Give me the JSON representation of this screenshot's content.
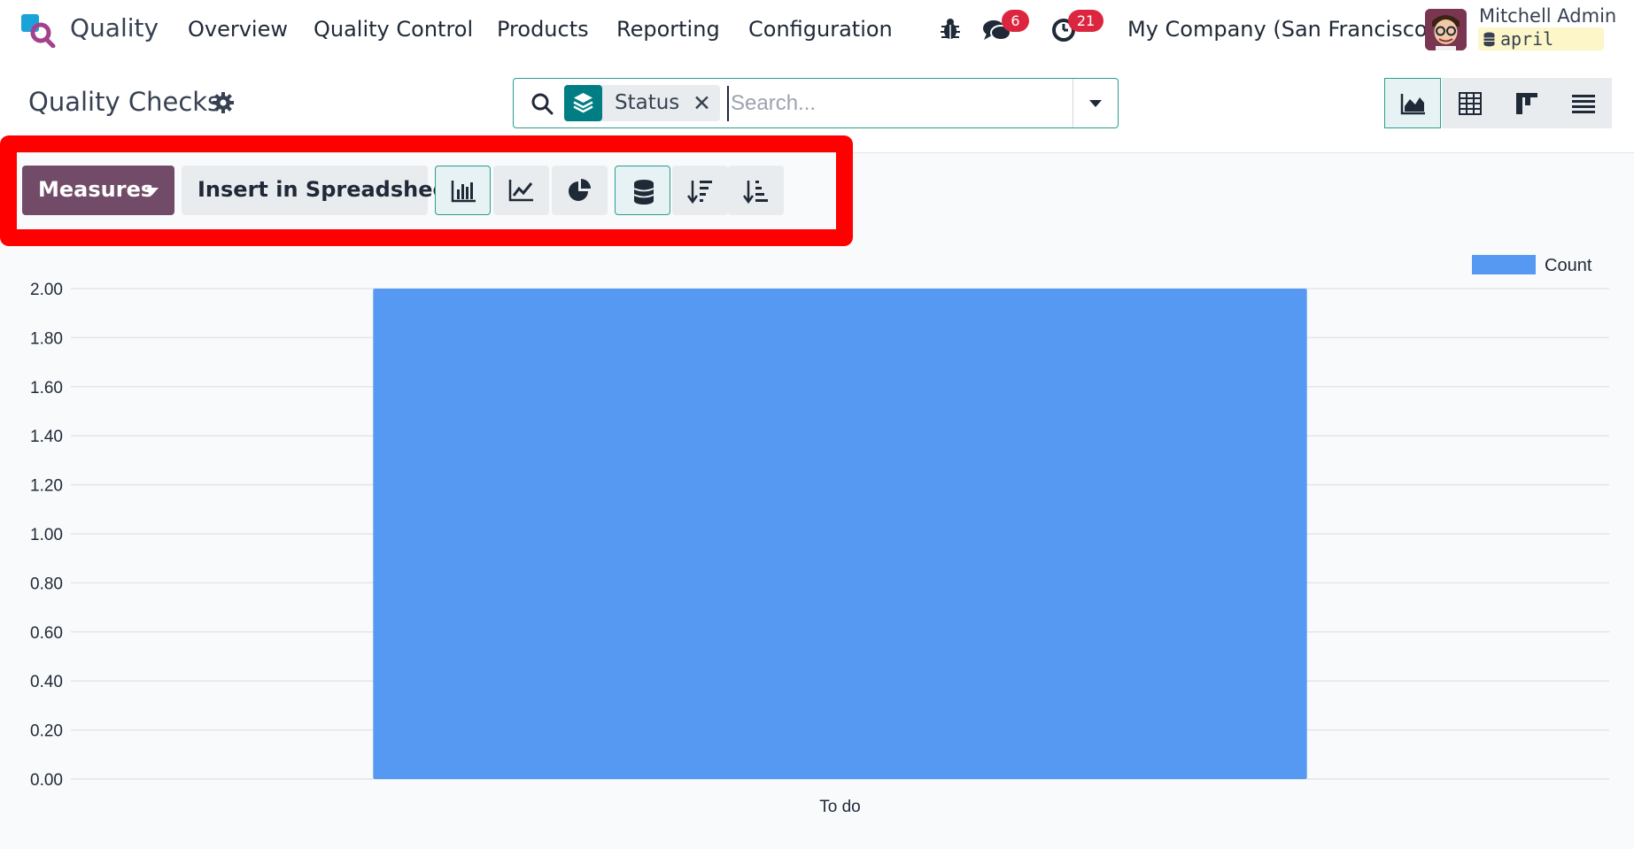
{
  "app": {
    "name": "Quality"
  },
  "menu": [
    "Overview",
    "Quality Control",
    "Products",
    "Reporting",
    "Configuration"
  ],
  "systray": {
    "debug_icon": "bug-icon",
    "messages_count": "6",
    "activities_count": "21",
    "company": "My Company (San Francisco)",
    "user_name": "Mitchell Admin",
    "database": "april"
  },
  "control": {
    "title": "Quality Checks",
    "facet_label": "Status",
    "search_placeholder": "Search..."
  },
  "toolbar": {
    "measures_label": "Measures",
    "spreadsheet_label": "Insert in Spreadsheet",
    "tools": [
      "bar-chart-icon",
      "line-chart-icon",
      "pie-chart-icon",
      "stacked-icon",
      "sort-descending-icon",
      "sort-ascending-icon"
    ]
  },
  "views": [
    "graph-view-icon",
    "pivot-view-icon",
    "kanban-view-icon",
    "list-view-icon"
  ],
  "colors": {
    "accent": "#714b67",
    "teal": "#017e84",
    "bar": "#5599f2",
    "badge": "#dc2640"
  },
  "chart_data": {
    "type": "bar",
    "categories": [
      "To do"
    ],
    "series": [
      {
        "name": "Count",
        "values": [
          2
        ]
      }
    ],
    "ylim": [
      0,
      2
    ],
    "yticks": [
      "0.00",
      "0.20",
      "0.40",
      "0.60",
      "0.80",
      "1.00",
      "1.20",
      "1.40",
      "1.60",
      "1.80",
      "2.00"
    ],
    "legend": "top-right",
    "grid": true
  }
}
